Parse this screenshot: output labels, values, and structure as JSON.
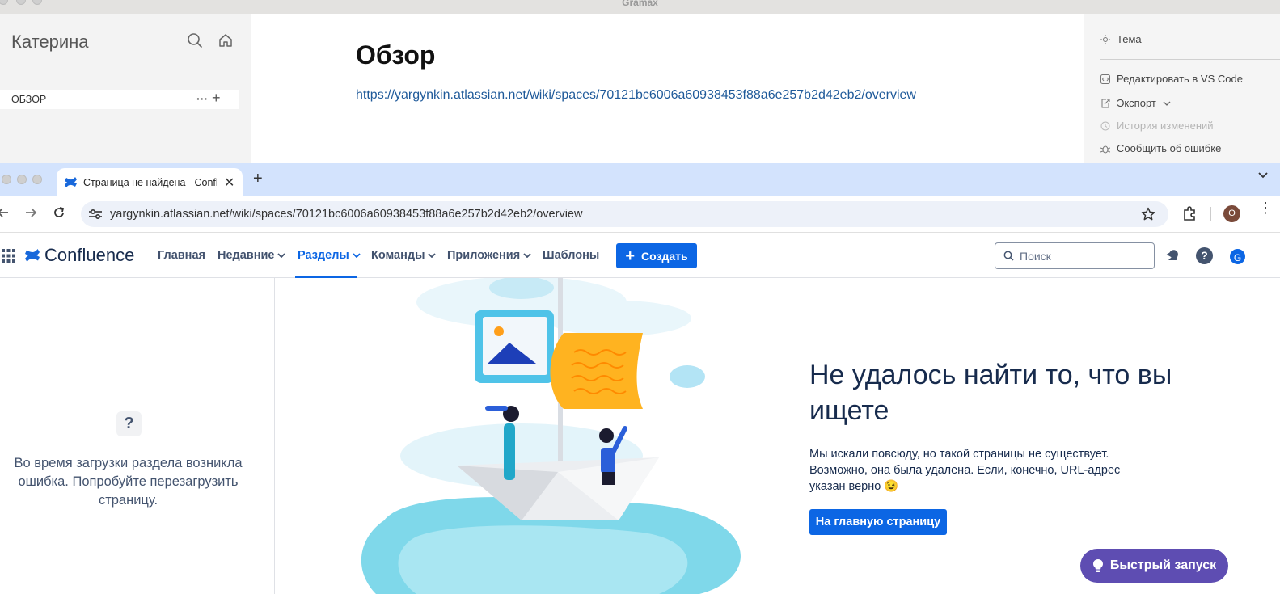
{
  "gramax": {
    "window_title": "Gramax",
    "user_name": "Катерина",
    "section_label": "ОБЗОР",
    "main_title": "Обзор",
    "link": "https://yargynkin.atlassian.net/wiki/spaces/70121bc6006a60938453f88a6e257b2d42eb2/overview",
    "menu": {
      "theme": "Тема",
      "edit_vscode": "Редактировать в VS Code",
      "export": "Экспорт",
      "history": "История изменений",
      "report_bug": "Сообщить об ошибке"
    }
  },
  "browser": {
    "tab_title": "Страница не найдена - Confluence",
    "url": "yargynkin.atlassian.net/wiki/spaces/70121bc6006a60938453f88a6e257b2d42eb2/overview",
    "profile_initial": "O"
  },
  "confluence": {
    "brand": "Confluence",
    "nav": {
      "home": "Главная",
      "recent": "Недавние",
      "spaces": "Разделы",
      "teams": "Команды",
      "apps": "Приложения",
      "templates": "Шаблоны"
    },
    "create_label": "Создать",
    "search_placeholder": "Поиск",
    "avatar_initial": "G",
    "sidebar_error": "Во время загрузки раздела возникла ошибка. Попробуйте перезагрузить страницу.",
    "heading": "Не удалось найти то, что вы ищете",
    "description": "Мы искали повсюду, но такой страницы не существует. Возможно, она была удалена. Если, конечно, URL-адрес указан верно 😉",
    "home_button": "На главную страницу",
    "quick_start": "Быстрый запуск"
  },
  "colors": {
    "confluence_blue": "#0c66e4",
    "quick_start_purple": "#5e4db2",
    "tabstrip": "#d3e3fd"
  }
}
